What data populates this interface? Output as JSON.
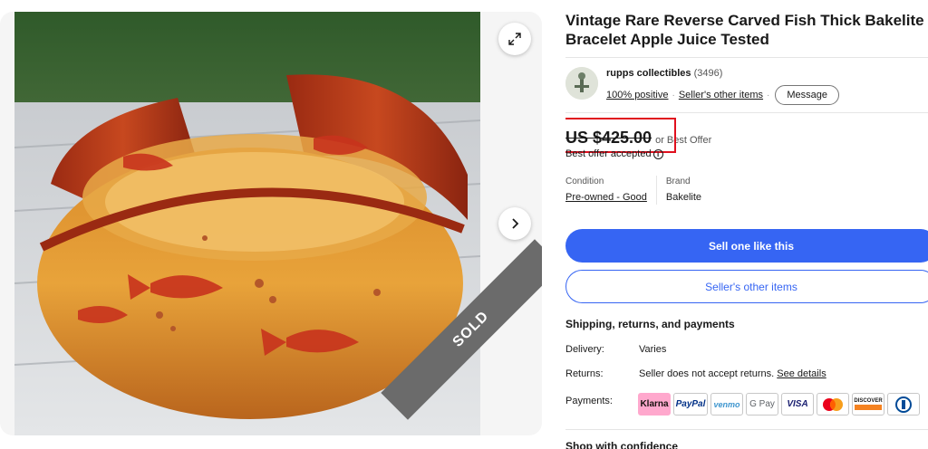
{
  "listing": {
    "title": "Vintage Rare Reverse Carved Fish Thick Bakelite Bracelet Apple Juice Tested",
    "sold_ribbon": "SOLD"
  },
  "seller": {
    "name": "rupps collectibles",
    "feedback_count": "(3496)",
    "positive": "100% positive",
    "other_items_link": "Seller's other items",
    "message_button": "Message"
  },
  "pricing": {
    "price": "US $425.00",
    "or_best_offer": "or Best Offer",
    "best_offer_accepted": "Best offer accepted"
  },
  "attributes": {
    "condition_label": "Condition",
    "condition_value": "Pre-owned - Good",
    "brand_label": "Brand",
    "brand_value": "Bakelite"
  },
  "actions": {
    "sell_one_like_this": "Sell one like this",
    "sellers_other_items": "Seller's other items"
  },
  "shipping": {
    "heading": "Shipping, returns, and payments",
    "delivery_label": "Delivery:",
    "delivery_value": "Varies",
    "returns_label": "Returns:",
    "returns_value": "Seller does not accept returns.",
    "returns_link": "See details",
    "payments_label": "Payments:"
  },
  "payment_methods": {
    "klarna": "Klarna",
    "paypal": "PayPal",
    "venmo": "venmo",
    "gpay": "G Pay",
    "visa": "VISA",
    "discover": "DISCOVER"
  },
  "confidence_heading": "Shop with confidence",
  "colors": {
    "primary_blue": "#3665f3",
    "highlight_red": "#e0101e",
    "sold_gray": "#6b6b6b"
  }
}
